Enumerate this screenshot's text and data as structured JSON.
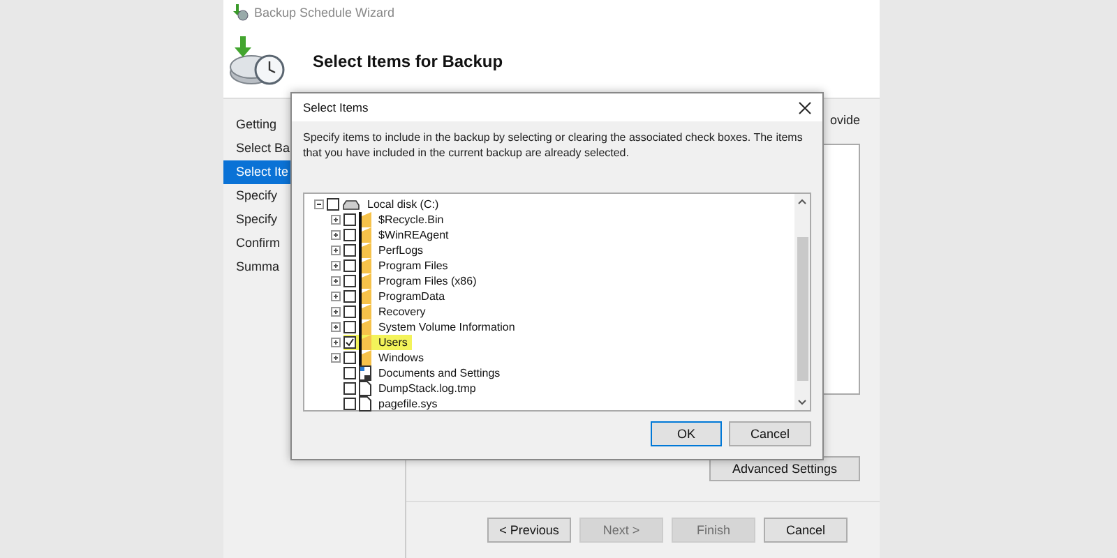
{
  "window": {
    "title": "Backup Schedule Wizard"
  },
  "header": {
    "title": "Select Items for Backup"
  },
  "steps": [
    {
      "label": "Getting",
      "selected": false
    },
    {
      "label": "Select Ba",
      "selected": false
    },
    {
      "label": "Select Ite",
      "selected": true
    },
    {
      "label": "Specify",
      "selected": false
    },
    {
      "label": "Specify",
      "selected": false
    },
    {
      "label": "Confirm",
      "selected": false
    },
    {
      "label": "Summa",
      "selected": false
    }
  ],
  "content": {
    "intro_fragment": "ovide",
    "advanced_button": "Advanced Settings"
  },
  "footer_buttons": [
    {
      "label": "< Previous",
      "disabled": false
    },
    {
      "label": "Next >",
      "disabled": true
    },
    {
      "label": "Finish",
      "disabled": true
    },
    {
      "label": "Cancel",
      "disabled": false
    }
  ],
  "dialog": {
    "title": "Select Items",
    "description": "Specify items to include in the backup by selecting or clearing the associated check boxes. The items that you have included in the current backup are already selected.",
    "tree": [
      {
        "label": "Local disk (C:)",
        "kind": "drive",
        "expanded": true,
        "checked": false,
        "children": [
          {
            "label": "$Recycle.Bin",
            "kind": "folder",
            "expanded": false,
            "checked": false,
            "highlighted": false
          },
          {
            "label": "$WinREAgent",
            "kind": "folder",
            "expanded": false,
            "checked": false,
            "highlighted": false
          },
          {
            "label": "PerfLogs",
            "kind": "folder",
            "expanded": false,
            "checked": false,
            "highlighted": false
          },
          {
            "label": "Program Files",
            "kind": "folder",
            "expanded": false,
            "checked": false,
            "highlighted": false
          },
          {
            "label": "Program Files (x86)",
            "kind": "folder",
            "expanded": false,
            "checked": false,
            "highlighted": false
          },
          {
            "label": "ProgramData",
            "kind": "folder",
            "expanded": false,
            "checked": false,
            "highlighted": false
          },
          {
            "label": "Recovery",
            "kind": "folder",
            "expanded": false,
            "checked": false,
            "highlighted": false
          },
          {
            "label": "System Volume Information",
            "kind": "folder",
            "expanded": false,
            "checked": false,
            "highlighted": false
          },
          {
            "label": "Users",
            "kind": "folder",
            "expanded": false,
            "checked": true,
            "highlighted": true
          },
          {
            "label": "Windows",
            "kind": "folder",
            "expanded": false,
            "checked": false,
            "highlighted": false
          },
          {
            "label": "Documents and Settings",
            "kind": "shortcut",
            "checked": false,
            "highlighted": false
          },
          {
            "label": "DumpStack.log.tmp",
            "kind": "file",
            "checked": false,
            "highlighted": false
          },
          {
            "label": "pagefile.sys",
            "kind": "file",
            "checked": false,
            "highlighted": false
          }
        ]
      }
    ],
    "buttons": [
      {
        "label": "OK",
        "default": true
      },
      {
        "label": "Cancel",
        "default": false
      }
    ]
  }
}
